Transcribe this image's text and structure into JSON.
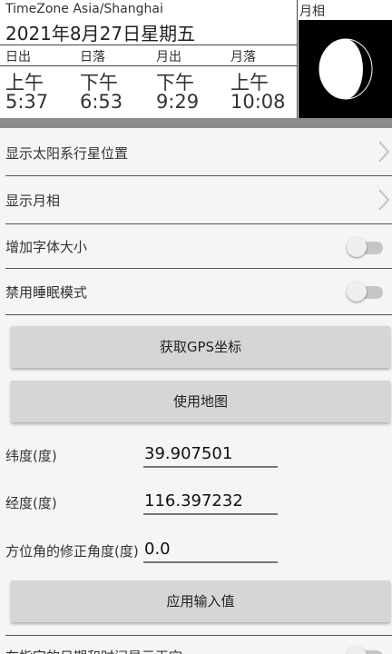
{
  "header": {
    "timezone": "TimeZone Asia/Shanghai",
    "date": "2021年8月27日星期五",
    "columns": [
      {
        "label": "日出",
        "ampm": "上午",
        "time": "5:37"
      },
      {
        "label": "日落",
        "ampm": "下午",
        "time": "6:53"
      },
      {
        "label": "月出",
        "ampm": "下午",
        "time": "9:29"
      },
      {
        "label": "月落",
        "ampm": "上午",
        "time": "10:08"
      }
    ],
    "moon_label": "月相"
  },
  "settings": {
    "show_planets": "显示太阳系行星位置",
    "show_moon_phase": "显示月相",
    "increase_font": "增加字体大小",
    "disable_sleep": "禁用睡眠模式",
    "bottom_partial": "在指定的日期和时间显示天空"
  },
  "toggles": {
    "increase_font": false,
    "disable_sleep": false,
    "bottom_partial": false
  },
  "buttons": {
    "get_gps": "获取GPS坐标",
    "use_map": "使用地图",
    "apply_input": "应用输入值"
  },
  "fields": {
    "latitude_label": "纬度(度)",
    "latitude_value": "39.907501",
    "longitude_label": "经度(度)",
    "longitude_value": "116.397232",
    "azimuth_label": "方位角的修正角度(度)",
    "azimuth_value": "0.0"
  },
  "icons": {
    "chevron": "chevron-right-icon",
    "moon": "moon-phase-icon"
  },
  "colors": {
    "background": "#f5f5f5",
    "button": "#d6d6d6",
    "bar": "#8c8c8c",
    "moon_bg": "#000000"
  }
}
